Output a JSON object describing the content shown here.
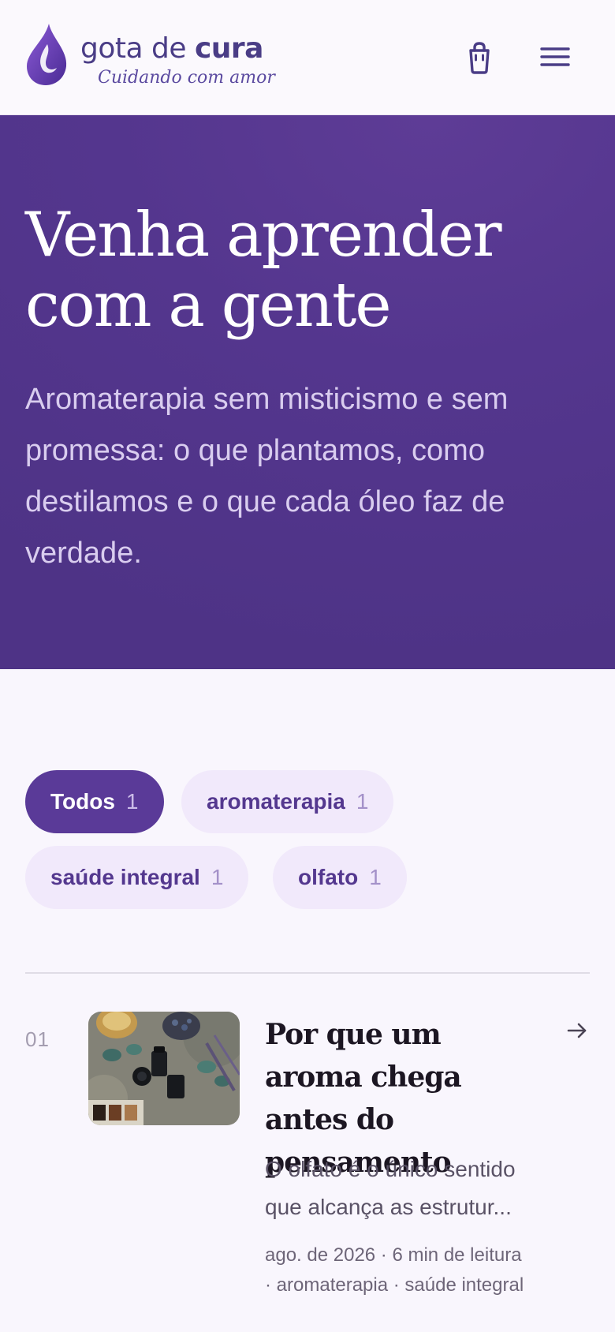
{
  "header": {
    "logo_name_light": "gota de ",
    "logo_name_bold": "cura",
    "logo_tagline": "Cuidando com amor",
    "cart_icon": "shopping-bag-icon",
    "menu_icon": "hamburger-menu-icon"
  },
  "hero": {
    "title_line1": "Venha aprender",
    "title_line2": "com a gente",
    "subtitle": "Aromaterapia sem misticismo e sem promessa: o que plantamos, como destilamos e o que cada óleo faz de verdade."
  },
  "filters": [
    {
      "label": "Todos",
      "count": "1",
      "active": true
    },
    {
      "label": "aromaterapia",
      "count": "1",
      "active": false
    },
    {
      "label": "saúde integral",
      "count": "1",
      "active": false
    },
    {
      "label": "olfato",
      "count": "1",
      "active": false
    }
  ],
  "articles": [
    {
      "number": "01",
      "title": "Por que um aroma chega antes do pensamento",
      "excerpt": "O olfato é o único sentido que alcança as estrutur...",
      "meta": "ago. de 2026 · 6 min de leitura · aromaterapia · saúde integral",
      "arrow_icon": "arrow-right-icon"
    }
  ],
  "colors": {
    "brand_purple": "#5a3a98",
    "hero_bg": "#54368e",
    "chip_bg": "#f1e9fb",
    "page_bg": "#f9f6fd"
  }
}
